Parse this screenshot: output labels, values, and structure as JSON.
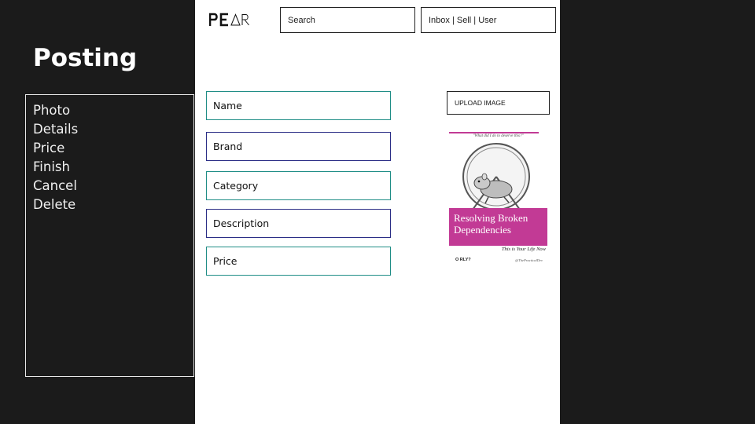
{
  "page": {
    "title": "Posting"
  },
  "side_menu": {
    "items": [
      {
        "label": "Photo"
      },
      {
        "label": "Details"
      },
      {
        "label": "Price"
      },
      {
        "label": "Finish"
      },
      {
        "label": "Cancel"
      },
      {
        "label": "Delete"
      }
    ]
  },
  "header": {
    "logo_text": "PEAR",
    "search": {
      "value": "Search"
    },
    "user_nav": {
      "label": "Inbox | Sell | User"
    }
  },
  "form": {
    "fields": [
      {
        "label": "Name",
        "border_color": "#1f8d86"
      },
      {
        "label": "Brand",
        "border_color": "#2b2e86"
      },
      {
        "label": "Category",
        "border_color": "#1f8d86"
      },
      {
        "label": "Description",
        "border_color": "#2b2e86"
      },
      {
        "label": "Price",
        "border_color": "#1f8d86"
      }
    ],
    "upload_button": {
      "label": "UPLOAD IMAGE"
    }
  },
  "book_cover": {
    "quote": "\"What did I do to deserve this?\"",
    "title": "Resolving Broken Dependencies",
    "subtitle": "This is Your Life Now",
    "publisher": "O RLY?",
    "author": "@ThePracticalDev",
    "accent_color": "#c23a95"
  },
  "colors": {
    "background": "#1b1b1b",
    "panel": "#ffffff",
    "teal_border": "#1f8d86",
    "navy_border": "#2b2e86"
  }
}
